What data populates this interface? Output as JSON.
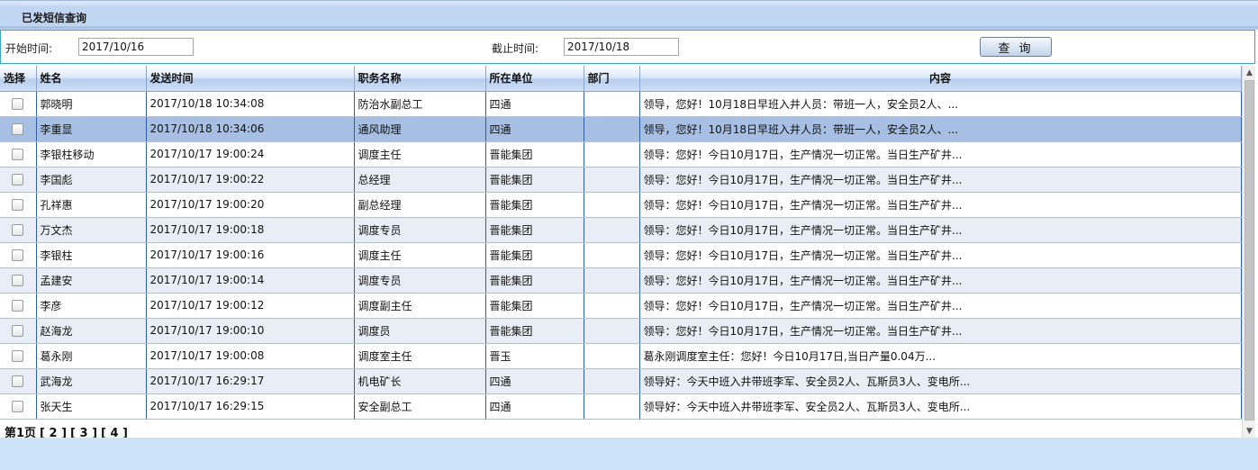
{
  "header": {
    "title": "已发短信查询"
  },
  "filter": {
    "start_label": "开始时间:",
    "start_value": "2017/10/16",
    "end_label": "截止时间:",
    "end_value": "2017/10/18",
    "query_button": "查 询"
  },
  "table": {
    "columns": [
      "选择",
      "姓名",
      "发送时间",
      "职务名称",
      "所在单位",
      "部门",
      "内容"
    ],
    "selected_row": 1,
    "rows": [
      {
        "name": "郭晓明",
        "time": "2017/10/18 10:34:08",
        "title": "防治水副总工",
        "unit": "四通",
        "dept": "",
        "content": "领导，您好！10月18日早班入井人员：带班一人，安全员2人、..."
      },
      {
        "name": "李重显",
        "time": "2017/10/18 10:34:06",
        "title": "通风助理",
        "unit": "四通",
        "dept": "",
        "content": "领导，您好！10月18日早班入井人员：带班一人，安全员2人、..."
      },
      {
        "name": "李银柱移动",
        "time": "2017/10/17 19:00:24",
        "title": "调度主任",
        "unit": "晋能集团",
        "dept": "",
        "content": "领导：您好！今日10月17日，生产情况一切正常。当日生产矿井..."
      },
      {
        "name": "李国彪",
        "time": "2017/10/17 19:00:22",
        "title": "总经理",
        "unit": "晋能集团",
        "dept": "",
        "content": "领导：您好！今日10月17日，生产情况一切正常。当日生产矿井..."
      },
      {
        "name": "孔祥惠",
        "time": "2017/10/17 19:00:20",
        "title": "副总经理",
        "unit": "晋能集团",
        "dept": "",
        "content": "领导：您好！今日10月17日，生产情况一切正常。当日生产矿井..."
      },
      {
        "name": "万文杰",
        "time": "2017/10/17 19:00:18",
        "title": "调度专员",
        "unit": "晋能集团",
        "dept": "",
        "content": "领导：您好！今日10月17日，生产情况一切正常。当日生产矿井..."
      },
      {
        "name": "李银柱",
        "time": "2017/10/17 19:00:16",
        "title": "调度主任",
        "unit": "晋能集团",
        "dept": "",
        "content": "领导：您好！今日10月17日，生产情况一切正常。当日生产矿井..."
      },
      {
        "name": "孟建安",
        "time": "2017/10/17 19:00:14",
        "title": "调度专员",
        "unit": "晋能集团",
        "dept": "",
        "content": "领导：您好！今日10月17日，生产情况一切正常。当日生产矿井..."
      },
      {
        "name": "李彦",
        "time": "2017/10/17 19:00:12",
        "title": "调度副主任",
        "unit": "晋能集团",
        "dept": "",
        "content": "领导：您好！今日10月17日，生产情况一切正常。当日生产矿井..."
      },
      {
        "name": "赵海龙",
        "time": "2017/10/17 19:00:10",
        "title": "调度员",
        "unit": "晋能集团",
        "dept": "",
        "content": "领导：您好！今日10月17日，生产情况一切正常。当日生产矿井..."
      },
      {
        "name": "葛永刚",
        "time": "2017/10/17 19:00:08",
        "title": "调度室主任",
        "unit": "晋玉",
        "dept": "",
        "content": "葛永刚调度室主任：您好！今日10月17日,当日产量0.04万..."
      },
      {
        "name": "武海龙",
        "time": "2017/10/17 16:29:17",
        "title": "机电矿长",
        "unit": "四通",
        "dept": "",
        "content": "领导好：今天中班入井带班李军、安全员2人、瓦斯员3人、变电所..."
      },
      {
        "name": "张天生",
        "time": "2017/10/17 16:29:15",
        "title": "安全副总工",
        "unit": "四通",
        "dept": "",
        "content": "领导好：今天中班入井带班李军、安全员2人、瓦斯员3人、变电所..."
      }
    ]
  },
  "pager": {
    "current": "第1页",
    "pages": [
      "[ 2 ]",
      "[ 3 ]",
      "[ 4 ]"
    ]
  },
  "scrollbar": {
    "up_icon": "arrow-up-icon",
    "down_icon": "arrow-down-icon"
  }
}
